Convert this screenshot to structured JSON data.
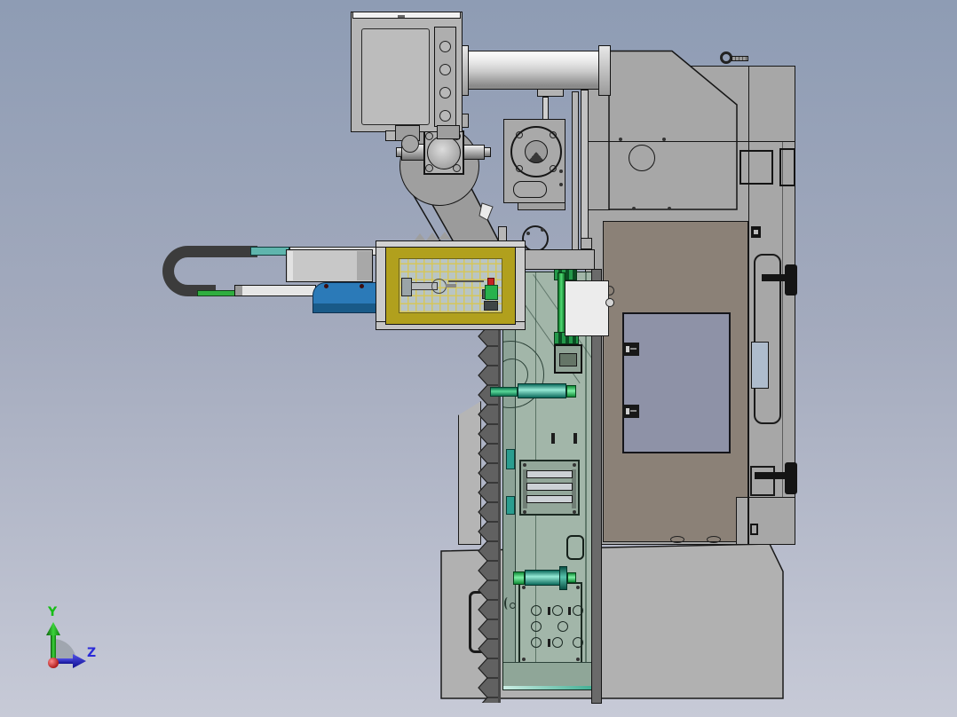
{
  "viewport": {
    "kind": "3D CAD model side view of industrial machine",
    "axis_triad": {
      "y_axis": {
        "label": "Y",
        "color": "#17bd17"
      },
      "z_axis": {
        "label": "Z",
        "color": "#2a2ad8"
      },
      "x_axis": {
        "color": "#c01010"
      }
    },
    "background": {
      "top_color": "#8e9cb4",
      "bottom_color": "#c7cad7"
    }
  },
  "palette": {
    "machine_gray": "#a7a7a7",
    "panel_light_gray": "#b5b5b5",
    "outline": "#161616",
    "guard_frame_yellow": "#b1a01d",
    "guard_mesh_yellow": "#d6c658",
    "guard_glass_blue": "#bac8d2",
    "safety_green": "#2fae3f",
    "shaft_teal": "#2a9d8f",
    "actuator_blue": "#2b7ab8",
    "cable_carrier_dark": "#3c3c3c",
    "door_panel_taupe": "#8b8177",
    "door_window_periwinkle": "#8e92a7",
    "side_window_blue": "#aebccd",
    "column_sage": "#a2b6a9",
    "base_gray": "#b1b1b1",
    "bellows_dark": "#616161",
    "highlight_red": "#c42222"
  }
}
